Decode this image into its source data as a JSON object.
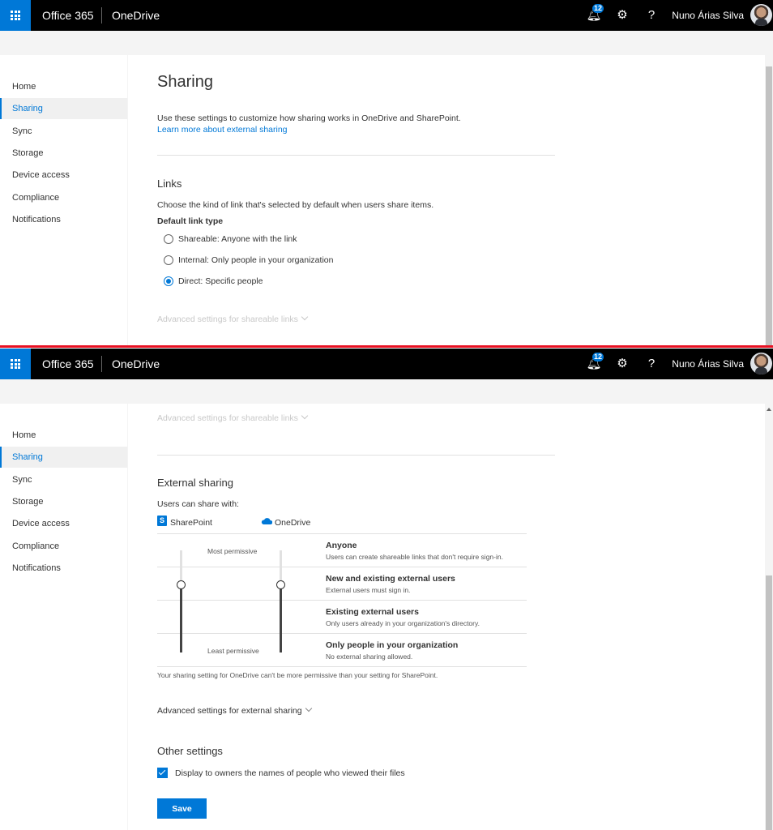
{
  "topbar": {
    "suite": "Office 365",
    "app": "OneDrive",
    "notification_count": "12",
    "user_name": "Nuno Árias Silva"
  },
  "nav": {
    "items": [
      "Home",
      "Sharing",
      "Sync",
      "Storage",
      "Device access",
      "Compliance",
      "Notifications"
    ],
    "active": "Sharing"
  },
  "sharing": {
    "title": "Sharing",
    "intro": "Use these settings to customize how sharing works in OneDrive and SharePoint.",
    "learn_more": "Learn more about external sharing"
  },
  "links": {
    "heading": "Links",
    "description": "Choose the kind of link that's selected by default when users share items.",
    "default_label": "Default link type",
    "options": [
      {
        "label": "Shareable: Anyone with the link",
        "checked": false
      },
      {
        "label": "Internal: Only people in your organization",
        "checked": false
      },
      {
        "label": "Direct: Specific people",
        "checked": true
      }
    ],
    "advanced": "Advanced settings for shareable links"
  },
  "external": {
    "heading": "External sharing",
    "users_can_share": "Users can share with:",
    "sharepoint": "SharePoint",
    "onedrive": "OneDrive",
    "most_permissive": "Most permissive",
    "least_permissive": "Least permissive",
    "levels": [
      {
        "title": "Anyone",
        "desc": "Users can create shareable links that don't require sign-in."
      },
      {
        "title": "New and existing external users",
        "desc": "External users must sign in."
      },
      {
        "title": "Existing external users",
        "desc": "Only users already in your organization's directory."
      },
      {
        "title": "Only people in your organization",
        "desc": "No external sharing allowed."
      }
    ],
    "sharepoint_level": 1,
    "onedrive_level": 1,
    "note": "Your sharing setting for OneDrive can't be more permissive than your setting for SharePoint.",
    "advanced": "Advanced settings for external sharing"
  },
  "other": {
    "heading": "Other settings",
    "checkbox_label": "Display to owners the names of people who viewed their files",
    "checked": true
  },
  "save_label": "Save",
  "colors": {
    "accent": "#0078d7",
    "topbar": "#000000",
    "separator": "#e81123"
  }
}
